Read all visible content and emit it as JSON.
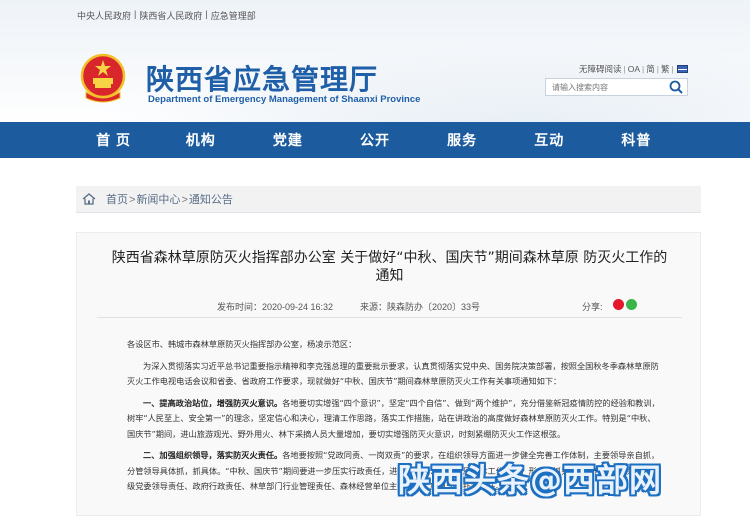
{
  "top_links": [
    "中央人民政府",
    "陕西省人民政府",
    "应急管理部"
  ],
  "site": {
    "name_cn": "陕西省应急管理厅",
    "name_en": "Department of Emergency Management of Shaanxi Province"
  },
  "utility": {
    "accessible": "无障碍阅读",
    "oa": "OA",
    "simplified": "简",
    "traditional": "繁"
  },
  "search": {
    "placeholder": "请输入搜索内容"
  },
  "nav": [
    "首 页",
    "机构",
    "党建",
    "公开",
    "服务",
    "互动",
    "科普"
  ],
  "breadcrumb": [
    "首页",
    "新闻中心",
    "通知公告"
  ],
  "article": {
    "title": "陕西省森林草原防灭火指挥部办公室 关于做好“中秋、国庆节”期间森林草原 防灭火工作的通知",
    "published": "发布时间：2020-09-24 16:32",
    "source": "来源：陕森防办〔2020〕33号",
    "share_label": "分享:",
    "salutation": "各设区市、韩城市森林草原防灭火指挥部办公室，杨凌示范区：",
    "para1": "为深入贯彻落实习近平总书记重要指示精神和李克强总理的重要批示要求，认真贯彻落实党中央、国务院决策部署，按照全国秋冬季森林草原防灭火工作电视电话会议和省委、省政府工作要求，现就做好“中秋、国庆节”期间森林草原防灭火工作有关事项通知如下：",
    "item1_head": "一、提高政治站位，增强防灭火意识。",
    "item1_body": "各地要切实增强“四个意识”，坚定“四个自信”、做到“两个维护”，充分借鉴新冠疫情防控的经验和教训，树牢“人民至上、安全第一”的理念，坚定信心和决心，理清工作思路，落实工作措施，站在讲政治的高度做好森林草原防灭火工作。特别是“中秋、国庆节”期间，进山旅游观光、野外用火、林下采摘人员大量增加，要切实增强防灭火意识，时刻紧绷防灭火工作这根弦。",
    "item2_head": "二、加强组织领导，落实防灭火责任。",
    "item2_body": "各地要按照“党政同责、一岗双责”的要求，在组织领导方面进一步健全完善工作体制，主要领导亲自抓，分管领导具体抓，抓具体。“中秋、国庆节”期间要进一步压实行政责任，进一步压实、压细、压具体工作责任，形成齐抓共管的工作合力，落实好各级党委领导责任、政府行政责任、林草部门行业管理责任、森林经营单位主体责任、应急部门扑救责任。"
  },
  "watermark": "陕西头条@西部网"
}
